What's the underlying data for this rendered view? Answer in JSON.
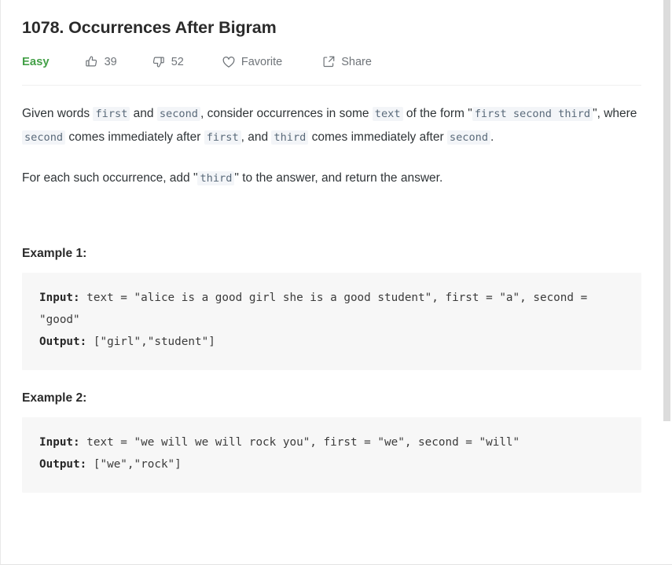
{
  "problem": {
    "title": "1078. Occurrences After Bigram",
    "difficulty": "Easy",
    "difficulty_color": "#43a047"
  },
  "toolbar": {
    "likes_icon": "thumbs-up-icon",
    "likes_count": "39",
    "dislikes_icon": "thumbs-down-icon",
    "dislikes_count": "52",
    "favorite_icon": "heart-icon",
    "favorite_label": "Favorite",
    "share_icon": "share-icon",
    "share_label": "Share"
  },
  "description": {
    "p1": {
      "t1": "Given words ",
      "c1": "first",
      "t2": " and ",
      "c2": "second",
      "t3": ", consider occurrences in some ",
      "c3": "text",
      "t4": " of the form \"",
      "c4": "first second third",
      "t5": "\", where ",
      "c5": "second",
      "t6": " comes immediately after ",
      "c6": "first",
      "t7": ", and ",
      "c7": "third",
      "t8": " comes immediately after ",
      "c8": "second",
      "t9": "."
    },
    "p2": {
      "t1": "For each such occurrence, add \"",
      "c1": "third",
      "t2": "\" to the answer, and return the answer."
    }
  },
  "examples": [
    {
      "heading": "Example 1:",
      "input_label": "Input:",
      "input_value": " text = \"alice is a good girl she is a good student\", first = \"a\", second = \"good\"",
      "output_label": "Output:",
      "output_value": " [\"girl\",\"student\"]"
    },
    {
      "heading": "Example 2:",
      "input_label": "Input:",
      "input_value": " text = \"we will we will rock you\", first = \"we\", second = \"will\"",
      "output_label": "Output:",
      "output_value": " [\"we\",\"rock\"]"
    }
  ],
  "scrollbar": {
    "thumb_color": "#dcdcdc"
  }
}
